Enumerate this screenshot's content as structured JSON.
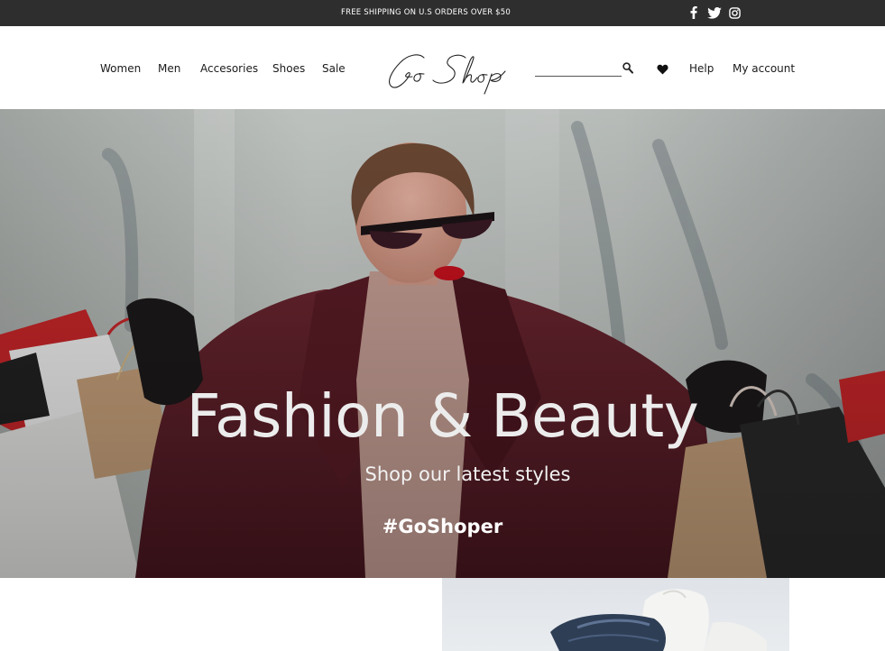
{
  "topbar": {
    "promo": "FREE SHIPPING ON U.S ORDERS OVER $50",
    "social": [
      "facebook-icon",
      "twitter-icon",
      "instagram-icon"
    ]
  },
  "header": {
    "nav": [
      "Women",
      "Men",
      "Accesories",
      "Shoes",
      "Sale"
    ],
    "logo_text": "Go Shop",
    "search": {
      "value": "",
      "placeholder": ""
    },
    "help": "Help",
    "account": "My account"
  },
  "hero": {
    "title": "Fashion & Beauty",
    "subtitle": "Shop our latest styles",
    "hashtag": "#GoShoper"
  },
  "colors": {
    "topbar_bg": "#2e2e2e",
    "text_dark": "#1a1a1a",
    "coat": "#5a1e26",
    "hero_text": "#ececec"
  }
}
